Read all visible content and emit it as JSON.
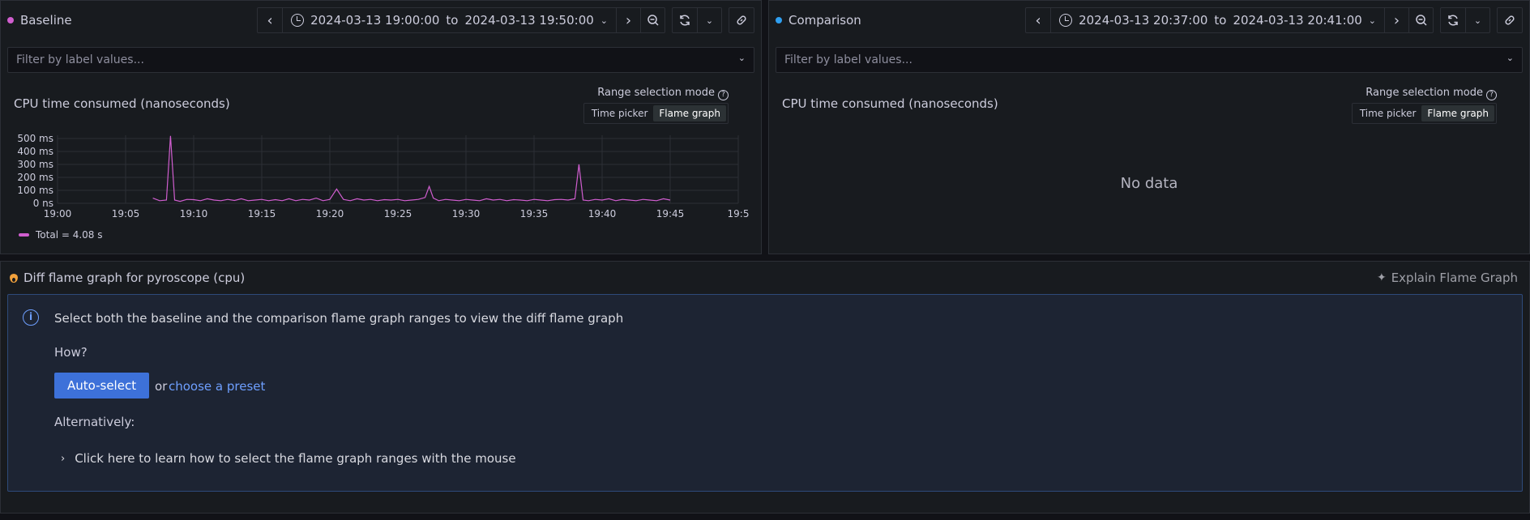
{
  "baseline": {
    "title": "Baseline",
    "dot_color": "#d05ecf",
    "time_range": {
      "from": "2024-03-13 19:00:00",
      "sep": "to",
      "to": "2024-03-13 19:50:00"
    },
    "filter_placeholder": "Filter by label values...",
    "chart_title": "CPU time consumed (nanoseconds)",
    "range_mode": {
      "label": "Range selection mode",
      "options": [
        "Time picker",
        "Flame graph"
      ],
      "selected": "Flame graph"
    },
    "legend": "Total = 4.08 s"
  },
  "comparison": {
    "title": "Comparison",
    "dot_color": "#2f9ff0",
    "time_range": {
      "from": "2024-03-13 20:37:00",
      "sep": "to",
      "to": "2024-03-13 20:41:00"
    },
    "filter_placeholder": "Filter by label values...",
    "chart_title": "CPU time consumed (nanoseconds)",
    "range_mode": {
      "label": "Range selection mode",
      "options": [
        "Time picker",
        "Flame graph"
      ],
      "selected": "Flame graph"
    },
    "no_data": "No data"
  },
  "diff": {
    "title": "Diff flame graph for pyroscope (cpu)",
    "explain_label": "Explain Flame Graph",
    "info_message": "Select both the baseline and the comparison flame graph ranges to view the diff flame graph",
    "how": "How?",
    "auto_select": "Auto-select",
    "or": "or",
    "preset_link": "choose a preset",
    "alternatively": "Alternatively:",
    "learn_more": "Click here to learn how to select the flame graph ranges with the mouse"
  },
  "chart_data": {
    "type": "line",
    "title": "CPU time consumed (nanoseconds)",
    "xlabel": "",
    "ylabel": "",
    "x_ticks": [
      "19:00",
      "19:05",
      "19:10",
      "19:15",
      "19:20",
      "19:25",
      "19:30",
      "19:35",
      "19:40",
      "19:45",
      "19:5"
    ],
    "y_ticks": [
      "0 ns",
      "100 ms",
      "200 ms",
      "300 ms",
      "400 ms",
      "500 ms"
    ],
    "xlim_minutes": [
      0,
      50
    ],
    "ylim_ms": [
      0,
      500
    ],
    "grid": true,
    "legend_position": "bottom-left",
    "series": [
      {
        "name": "Total = 4.08 s",
        "color": "#d05ecf",
        "x_minutes": [
          7.0,
          7.5,
          8.0,
          8.3,
          8.6,
          9.0,
          9.5,
          10.0,
          10.5,
          11.0,
          11.5,
          12.0,
          12.5,
          13.0,
          13.5,
          14.0,
          14.5,
          15.0,
          15.5,
          16.0,
          16.5,
          17.0,
          17.5,
          18.0,
          18.5,
          19.0,
          19.5,
          20.0,
          20.5,
          21.0,
          21.5,
          22.0,
          22.5,
          23.0,
          23.5,
          24.0,
          24.5,
          25.0,
          25.5,
          26.0,
          26.5,
          27.0,
          27.3,
          27.6,
          28.0,
          28.5,
          29.0,
          29.5,
          30.0,
          30.5,
          31.0,
          31.5,
          32.0,
          32.5,
          33.0,
          33.5,
          34.0,
          34.5,
          35.0,
          35.5,
          36.0,
          36.5,
          37.0,
          37.5,
          38.0,
          38.3,
          38.6,
          39.0,
          39.5,
          40.0,
          40.5,
          41.0,
          41.5,
          42.0,
          42.5,
          43.0,
          43.5,
          44.0,
          44.5,
          45.0
        ],
        "y_ms": [
          40,
          20,
          25,
          520,
          25,
          15,
          30,
          28,
          20,
          35,
          25,
          20,
          30,
          22,
          35,
          20,
          25,
          30,
          20,
          28,
          20,
          35,
          20,
          30,
          25,
          40,
          20,
          30,
          110,
          30,
          20,
          35,
          25,
          30,
          20,
          28,
          25,
          30,
          20,
          25,
          30,
          45,
          130,
          40,
          20,
          30,
          25,
          20,
          30,
          25,
          20,
          35,
          25,
          30,
          20,
          28,
          25,
          20,
          30,
          25,
          20,
          28,
          30,
          25,
          35,
          300,
          25,
          20,
          30,
          25,
          35,
          20,
          30,
          25,
          20,
          30,
          25,
          20,
          35,
          25
        ]
      }
    ]
  }
}
